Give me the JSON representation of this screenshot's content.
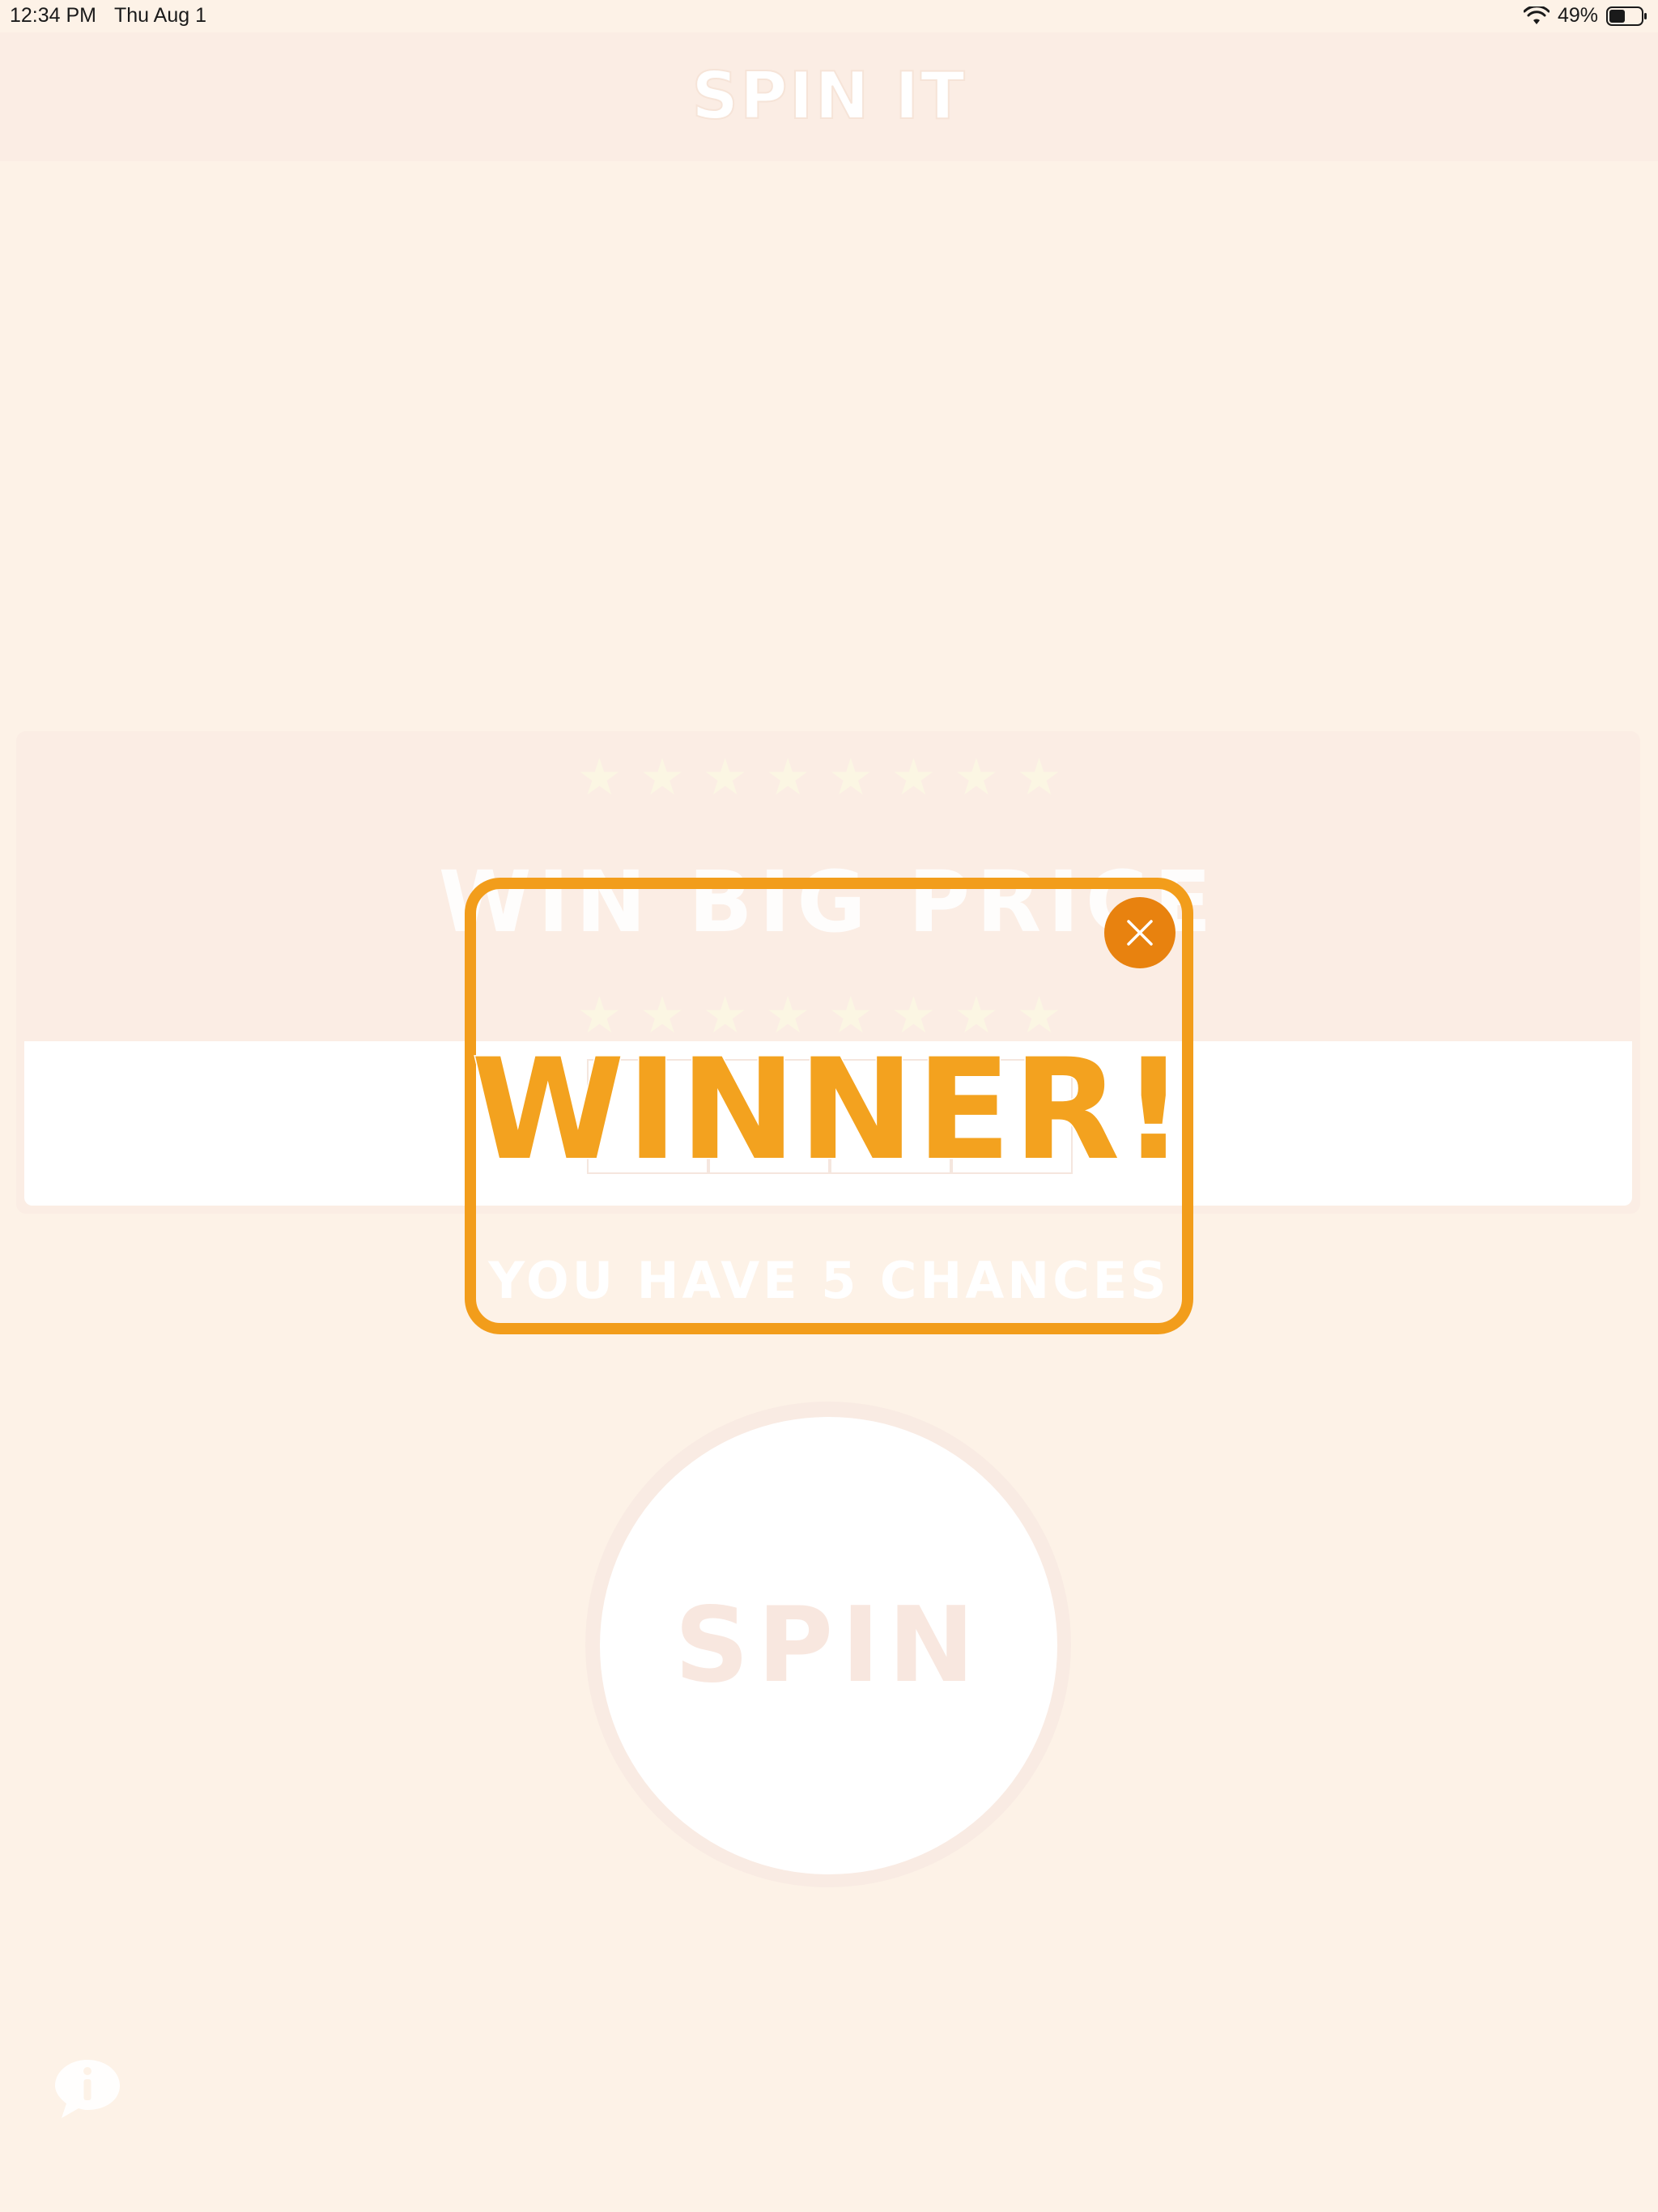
{
  "status_bar": {
    "time": "12:34 PM",
    "date": "Thu Aug 1",
    "battery": "49%"
  },
  "nav": {
    "title": "SPIN IT"
  },
  "banner": {
    "stars_top": "★★★★★★★★",
    "title": "WIN BIG PRICE",
    "stars_bottom": "★★★★★★★★"
  },
  "chances_text": "YOU HAVE 5 CHANCES",
  "spin_button": {
    "label": "SPIN"
  },
  "popup": {
    "title": "WINNER!"
  },
  "colors": {
    "background": "#fdf2e7",
    "nav_background": "#fbede4",
    "popup_accent": "#f29d1b",
    "close_button": "#e8820f"
  }
}
